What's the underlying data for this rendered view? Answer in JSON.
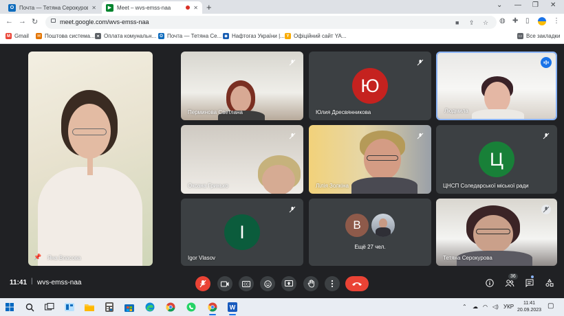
{
  "browser": {
    "tabs": [
      {
        "title": "Почта — Тетяна Серокурова —",
        "icon": "outlook-icon",
        "active": false
      },
      {
        "title": "Meet – wvs-emss-naa",
        "icon": "meet-icon",
        "active": true,
        "recording": true
      }
    ],
    "new_tab": "+",
    "address": {
      "url": "meet.google.com/wvs-emss-naa"
    },
    "all_bookmarks_label": "Все закладки"
  },
  "bookmarks": [
    {
      "label": "Gmail",
      "icon": "gmail-icon",
      "color": "#ea4335",
      "glyph": "M"
    },
    {
      "label": "Поштова система...",
      "icon": "mail-system-icon",
      "color": "#e37400",
      "glyph": "✉"
    },
    {
      "label": "Оплата комунальн...",
      "icon": "payment-icon",
      "color": "#5f6368",
      "glyph": "●"
    },
    {
      "label": "Почта — Тетяна Се...",
      "icon": "outlook-icon",
      "color": "#0f6cbd",
      "glyph": "O"
    },
    {
      "label": "Нафтогаз України |...",
      "icon": "naftogaz-icon",
      "color": "#1a5fb4",
      "glyph": "◆"
    },
    {
      "label": "Офіційний сайт YA...",
      "icon": "yasno-icon",
      "color": "#f9ab00",
      "glyph": "Y"
    }
  ],
  "participants": {
    "pinned": {
      "name": "Яна Власова"
    },
    "tiles": [
      {
        "name": "Перминова Светлана",
        "muted": true
      },
      {
        "name": "Юлия Дресвянникова",
        "muted": true,
        "initial": "Ю",
        "avatar_color": "#c5221f"
      },
      {
        "name": "Людмила",
        "muted": false,
        "speaking": true
      },
      {
        "name": "Оксана Гринько",
        "muted": true
      },
      {
        "name": "Лілія Золкіна",
        "muted": true
      },
      {
        "name": "ЦНСП Соледарської міської ради",
        "muted": true,
        "initial": "Ц",
        "avatar_color": "#188038"
      },
      {
        "name": "Igor Vlasov",
        "muted": true,
        "initial": "I",
        "avatar_color": "#0b5c3c"
      },
      {
        "more_label": "Ещё 27 чел.",
        "initial": "В",
        "avatar_color": "#8e5a4a"
      },
      {
        "name": "Тетяна Серокурова",
        "muted": true
      }
    ]
  },
  "meeting": {
    "time": "11:41",
    "code": "wvs-emss-naa",
    "people_count": "36"
  },
  "taskbar": {
    "language": "УКР",
    "time": "11:41",
    "date": "20.09.2023"
  }
}
